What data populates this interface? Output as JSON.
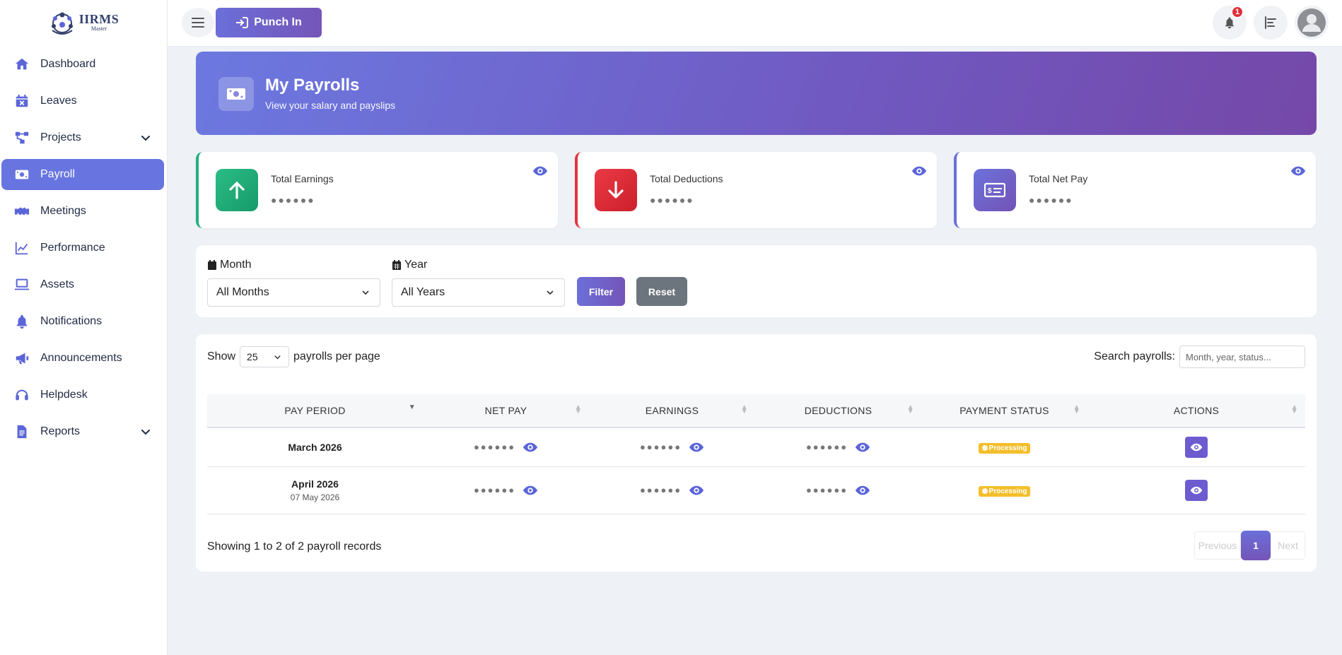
{
  "app": {
    "logo_title": "IIRMS",
    "logo_sub": "Master"
  },
  "sidebar": {
    "items": [
      {
        "label": "Dashboard",
        "icon": "home-icon"
      },
      {
        "label": "Leaves",
        "icon": "calendar-x-icon"
      },
      {
        "label": "Projects",
        "icon": "project-diagram-icon"
      },
      {
        "label": "Payroll",
        "icon": "money-bill-icon"
      },
      {
        "label": "Meetings",
        "icon": "handshake-icon"
      },
      {
        "label": "Performance",
        "icon": "chart-line-icon"
      },
      {
        "label": "Assets",
        "icon": "laptop-icon"
      },
      {
        "label": "Notifications",
        "icon": "bell-icon"
      },
      {
        "label": "Announcements",
        "icon": "bullhorn-icon"
      },
      {
        "label": "Helpdesk",
        "icon": "headset-icon"
      },
      {
        "label": "Reports",
        "icon": "file-icon"
      }
    ]
  },
  "topbar": {
    "punch_label": "Punch In",
    "notification_count": "1"
  },
  "hero": {
    "title": "My Payrolls",
    "subtitle": "View your salary and payslips"
  },
  "stats": [
    {
      "label": "Total Earnings",
      "value": "●●●●●●"
    },
    {
      "label": "Total Deductions",
      "value": "●●●●●●"
    },
    {
      "label": "Total Net Pay",
      "value": "●●●●●●"
    }
  ],
  "filters": {
    "month_label": "Month",
    "month_value": "All Months",
    "year_label": "Year",
    "year_value": "All Years",
    "filter_label": "Filter",
    "reset_label": "Reset"
  },
  "table": {
    "show_label": "Show",
    "per_page": "25",
    "per_page_suffix": "payrolls per page",
    "search_label": "Search payrolls:",
    "search_placeholder": "Month, year, status...",
    "headers": [
      "PAY PERIOD",
      "NET PAY",
      "EARNINGS",
      "DEDUCTIONS",
      "PAYMENT STATUS",
      "ACTIONS"
    ],
    "masked": "●●●●●●",
    "rows": [
      {
        "period": "March 2026",
        "period_sub": "",
        "status": "Processing"
      },
      {
        "period": "April 2026",
        "period_sub": "07 May 2026",
        "status": "Processing"
      }
    ],
    "summary": "Showing 1 to 2 of 2 payroll records",
    "prev": "Previous",
    "page": "1",
    "next": "Next"
  }
}
